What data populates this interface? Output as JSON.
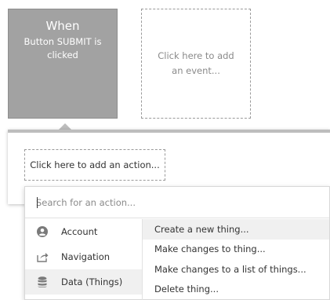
{
  "event": {
    "title": "When",
    "description": "Button SUBMIT is clicked"
  },
  "add_event_label": "Click here to add an event...",
  "add_action_label": "Click here to add an action...",
  "search": {
    "placeholder": "Search for an action..."
  },
  "categories": [
    {
      "label": "Account",
      "icon": "person-circle-icon"
    },
    {
      "label": "Navigation",
      "icon": "share-arrow-icon"
    },
    {
      "label": "Data (Things)",
      "icon": "database-icon"
    }
  ],
  "actions": [
    {
      "label": "Create a new thing..."
    },
    {
      "label": "Make changes to thing..."
    },
    {
      "label": "Make changes to a list of things..."
    },
    {
      "label": "Delete thing..."
    }
  ],
  "colors": {
    "event_card_bg": "#a2a2a2",
    "panel_border": "#bdbdbd",
    "highlight_bg": "#f0f0f0"
  }
}
